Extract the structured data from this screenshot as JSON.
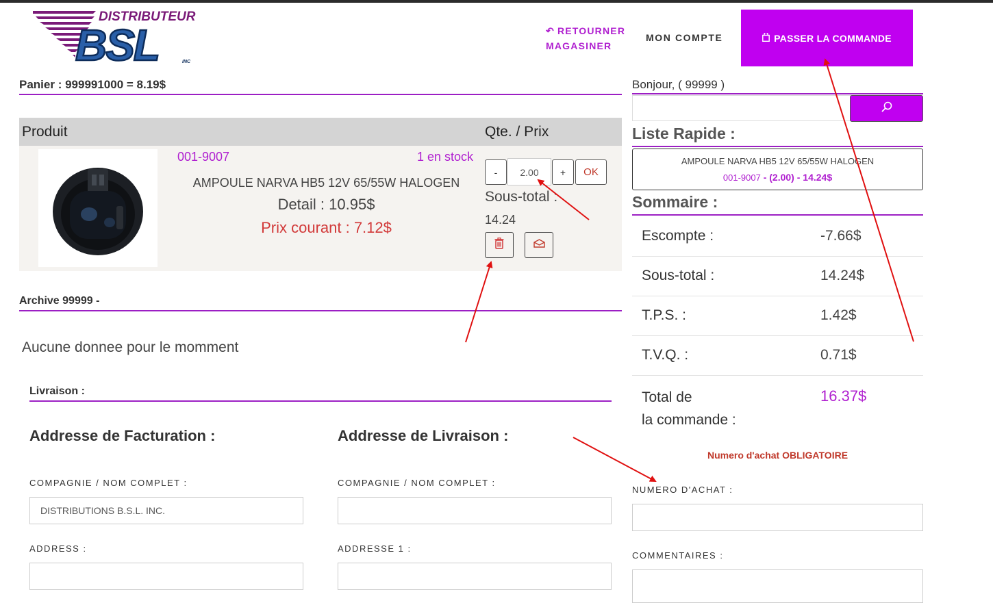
{
  "header": {
    "logo_top": "DISTRIBUTEUR",
    "logo_main": "BSL",
    "logo_sub": "INC",
    "back_label_line1": "RETOURNER",
    "back_label_line2": "MAGASINER",
    "account_label": "MON COMPTE",
    "order_label": "PASSER LA COMMANDE"
  },
  "cart": {
    "title": "Panier : 999991000 = 8.19$",
    "col_product": "Produit",
    "col_qty_price": "Qte. / Prix",
    "item": {
      "sku": "001-9007",
      "stock": "1 en stock",
      "name": "AMPOULE NARVA HB5 12V 65/55W HALOGEN",
      "detail": "Detail : 10.95$",
      "current_price": "Prix courant : 7.12$",
      "qty_minus": "-",
      "qty_value": "2.00",
      "qty_plus": "+",
      "ok_label": "OK",
      "subtotal_label": "Sous-total :",
      "subtotal_value": "14.24"
    }
  },
  "archive": {
    "title_prefix": "Archive ",
    "title_bold": "99999 -",
    "empty_message": "Aucune donnee pour le mom­ment"
  },
  "delivery": {
    "title": "Livraison :",
    "billing_title": "Addresse de Facturation :",
    "shipping_title": "Addresse de Livraison :",
    "billing_company_label": "COMPAGNIE / NOM COMPLET :",
    "billing_company_value": "DISTRIBUTIONS B.S.L. INC.",
    "billing_address_label": "ADDRESS :",
    "billing_address_value": "",
    "shipping_company_label": "COMPAGNIE / NOM COMPLET :",
    "shipping_company_value": "",
    "shipping_address_label": "ADDRESSE 1 :",
    "shipping_address_value": ""
  },
  "sidebar": {
    "greeting": "Bonjour, ( 99999 )",
    "search_value": "",
    "quick_list_title": "Liste Rapide :",
    "quick_item_name": "AMPOULE NARVA HB5 12V 65/55W HALOGEN",
    "quick_item_sku": "001-9007",
    "quick_item_detail": " - (2.00) - 14.24$",
    "summary_title": "Sommaire :",
    "summary": [
      {
        "label": "Escompte :",
        "value": "-7.66$"
      },
      {
        "label": "Sous-total :",
        "value": "14.24$"
      },
      {
        "label": "T.P.S. :",
        "value": "1.42$"
      },
      {
        "label": "T.V.Q. :",
        "value": "0.71$"
      }
    ],
    "total_label_line1": "Total de",
    "total_label_line2": "la commande :",
    "total_value": "16.37$",
    "required_notice": "Numero d'achat OBLIGATOIRE",
    "po_label": "NUMERO D'ACHAT :",
    "po_value": "",
    "comments_label": "COMMENTAIRES :",
    "comments_value": ""
  },
  "colors": {
    "accent": "#c000f0",
    "accent_text": "#b020d0",
    "rule": "#9c1fc4",
    "danger": "#c0392b",
    "annotation_arrow": "#e01010"
  },
  "icons": [
    "reply-arrow-icon",
    "shopping-bag-icon",
    "search-icon",
    "trash-icon",
    "envelope-icon"
  ]
}
